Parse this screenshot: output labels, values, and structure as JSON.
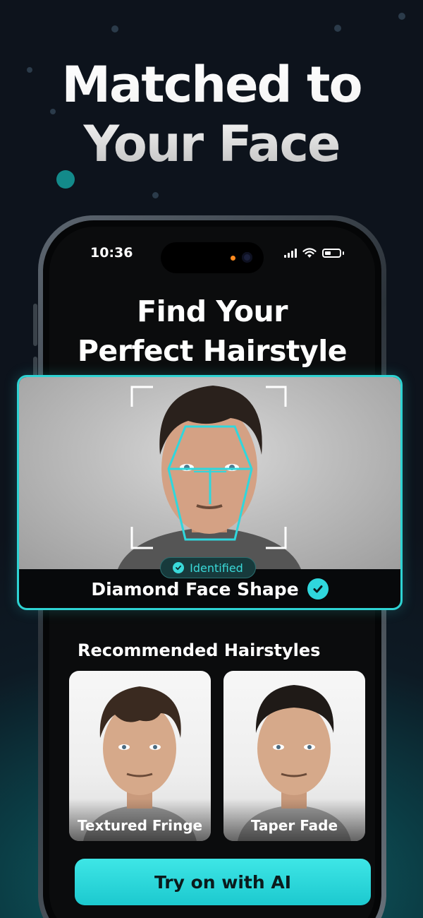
{
  "hero": {
    "line1": "Matched to",
    "line2": "Your Face"
  },
  "status_bar": {
    "time": "10:36",
    "icons": [
      "cellular-signal-icon",
      "wifi-icon",
      "battery-icon"
    ]
  },
  "screen": {
    "title_line1": "Find Your",
    "title_line2": "Perfect Hairstyle"
  },
  "analysis": {
    "badge": "Identified",
    "face_shape": "Diamond Face Shape",
    "icons": [
      "check-circle-icon"
    ]
  },
  "recommendations": {
    "heading": "Recommended Hairstyles",
    "items": [
      {
        "label": "Textured Fringe"
      },
      {
        "label": "Taper Fade"
      }
    ]
  },
  "cta": {
    "label": "Try on with AI"
  },
  "colors": {
    "accent": "#2ed3d3",
    "background": "#0d131c",
    "cta": "#22d0d6"
  }
}
